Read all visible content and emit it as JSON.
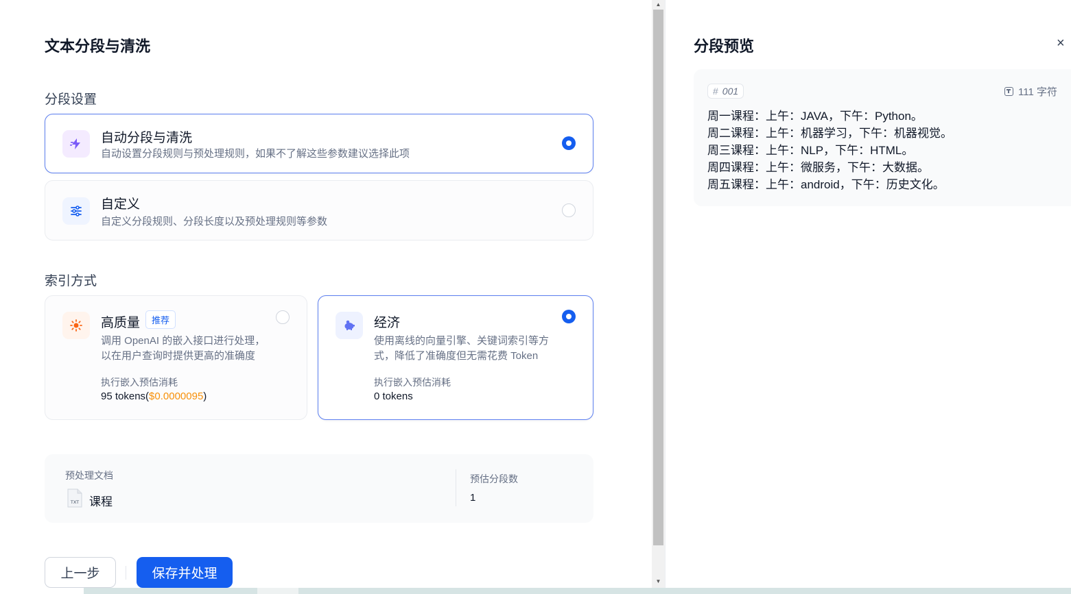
{
  "page": {
    "title": "文本分段与清洗"
  },
  "segment_settings": {
    "label": "分段设置",
    "options": [
      {
        "title": "自动分段与清洗",
        "desc": "自动设置分段规则与预处理规则，如果不了解这些参数建议选择此项",
        "selected": true,
        "icon": "lightning-icon"
      },
      {
        "title": "自定义",
        "desc": "自定义分段规则、分段长度以及预处理规则等参数",
        "selected": false,
        "icon": "sliders-icon"
      }
    ]
  },
  "index_method": {
    "label": "索引方式",
    "high_quality": {
      "title": "高质量",
      "badge": "推荐",
      "desc_line1": "调用 OpenAI 的嵌入接口进行处理，",
      "desc_line2": "以在用户查询时提供更高的准确度",
      "cost_label": "执行嵌入预估消耗",
      "cost_tokens": "95 tokens(",
      "cost_price": "$0.0000095",
      "cost_close": ")",
      "selected": false,
      "icon": "sun-icon"
    },
    "economy": {
      "title": "经济",
      "desc_line1": "使用离线的向量引擎、关键词索引等方",
      "desc_line2": "式，降低了准确度但无需花费 Token",
      "cost_label": "执行嵌入预估消耗",
      "cost_tokens": "0 tokens",
      "selected": true,
      "icon": "piggy-bank-icon"
    }
  },
  "info": {
    "doc_label": "预处理文档",
    "doc_name": "课程",
    "doc_type": "TXT",
    "seg_label": "预估分段数",
    "seg_count": "1"
  },
  "buttons": {
    "prev": "上一步",
    "save": "保存并处理"
  },
  "preview": {
    "title": "分段预览",
    "close": "×",
    "segment_id": "001",
    "char_count": "111 字符",
    "lines": [
      "周一课程：上午：JAVA，下午：Python。",
      "周二课程：上午：机器学习，下午：机器视觉。",
      "周三课程：上午：NLP，下午：HTML。",
      "周四课程：上午：微服务，下午：大数据。",
      "周五课程：上午：android，下午：历史文化。"
    ]
  },
  "colors": {
    "primary": "#155eef",
    "price": "#f79009",
    "active_border": "#5b7ef0"
  }
}
